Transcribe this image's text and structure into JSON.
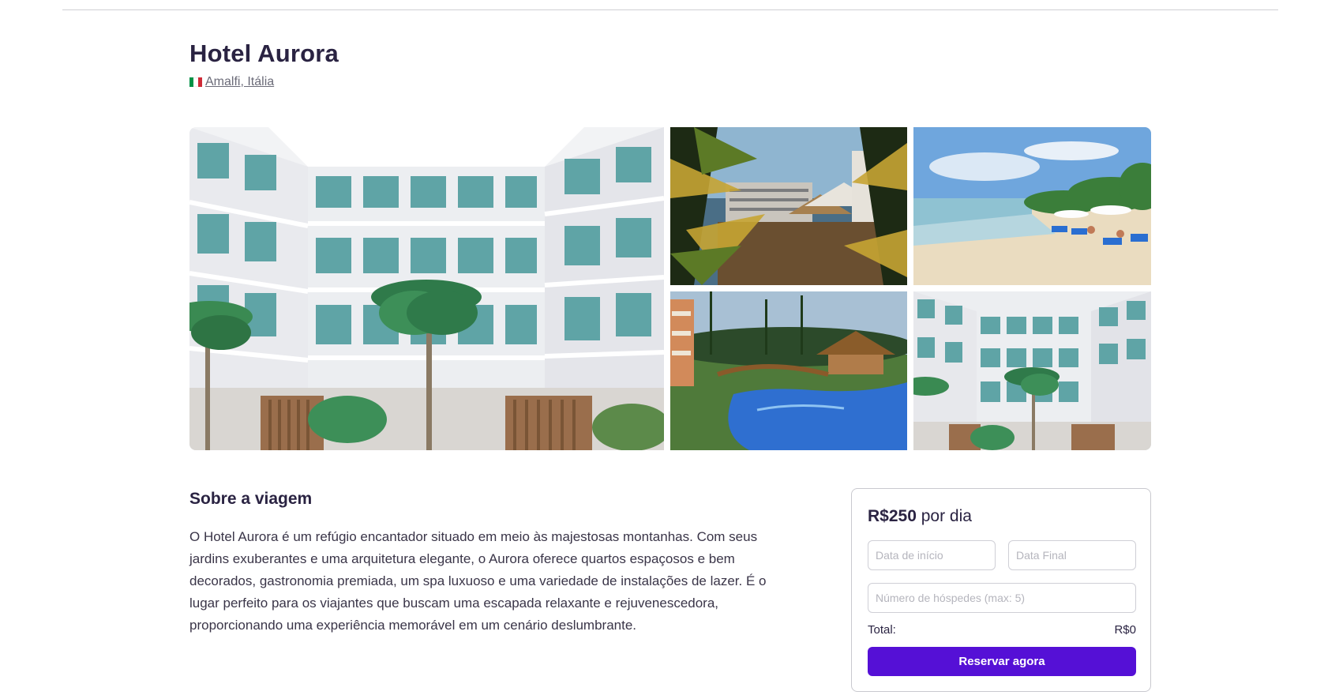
{
  "hotel": {
    "name": "Hotel Aurora",
    "location": "Amalfi, Itália",
    "flag_colors": [
      "#009246",
      "#ffffff",
      "#ce2b37"
    ]
  },
  "gallery": {
    "photos": [
      "hotel-facade-photo",
      "palm-resort-photo",
      "beach-photo",
      "pool-photo",
      "hotel-facade-photo"
    ]
  },
  "about": {
    "title": "Sobre a viagem",
    "text": "O Hotel Aurora é um refúgio encantador situado em meio às majestosas montanhas. Com seus jardins exuberantes e uma arquitetura elegante, o Aurora oferece quartos espaçosos e bem decorados, gastronomia premiada, um spa luxuoso e uma variedade de instalações de lazer. É o lugar perfeito para os viajantes que buscam uma escapada relaxante e rejuvenescedora, proporcionando uma experiência memorável em um cenário deslumbrante."
  },
  "booking": {
    "price": "R$250",
    "price_suffix": " por dia",
    "start_placeholder": "Data de início",
    "end_placeholder": "Data Final",
    "guests_placeholder": "Número de hóspedes (max: 5)",
    "total_label": "Total:",
    "total_value": "R$0",
    "button_label": "Reservar agora",
    "accent_color": "#5510d6"
  }
}
